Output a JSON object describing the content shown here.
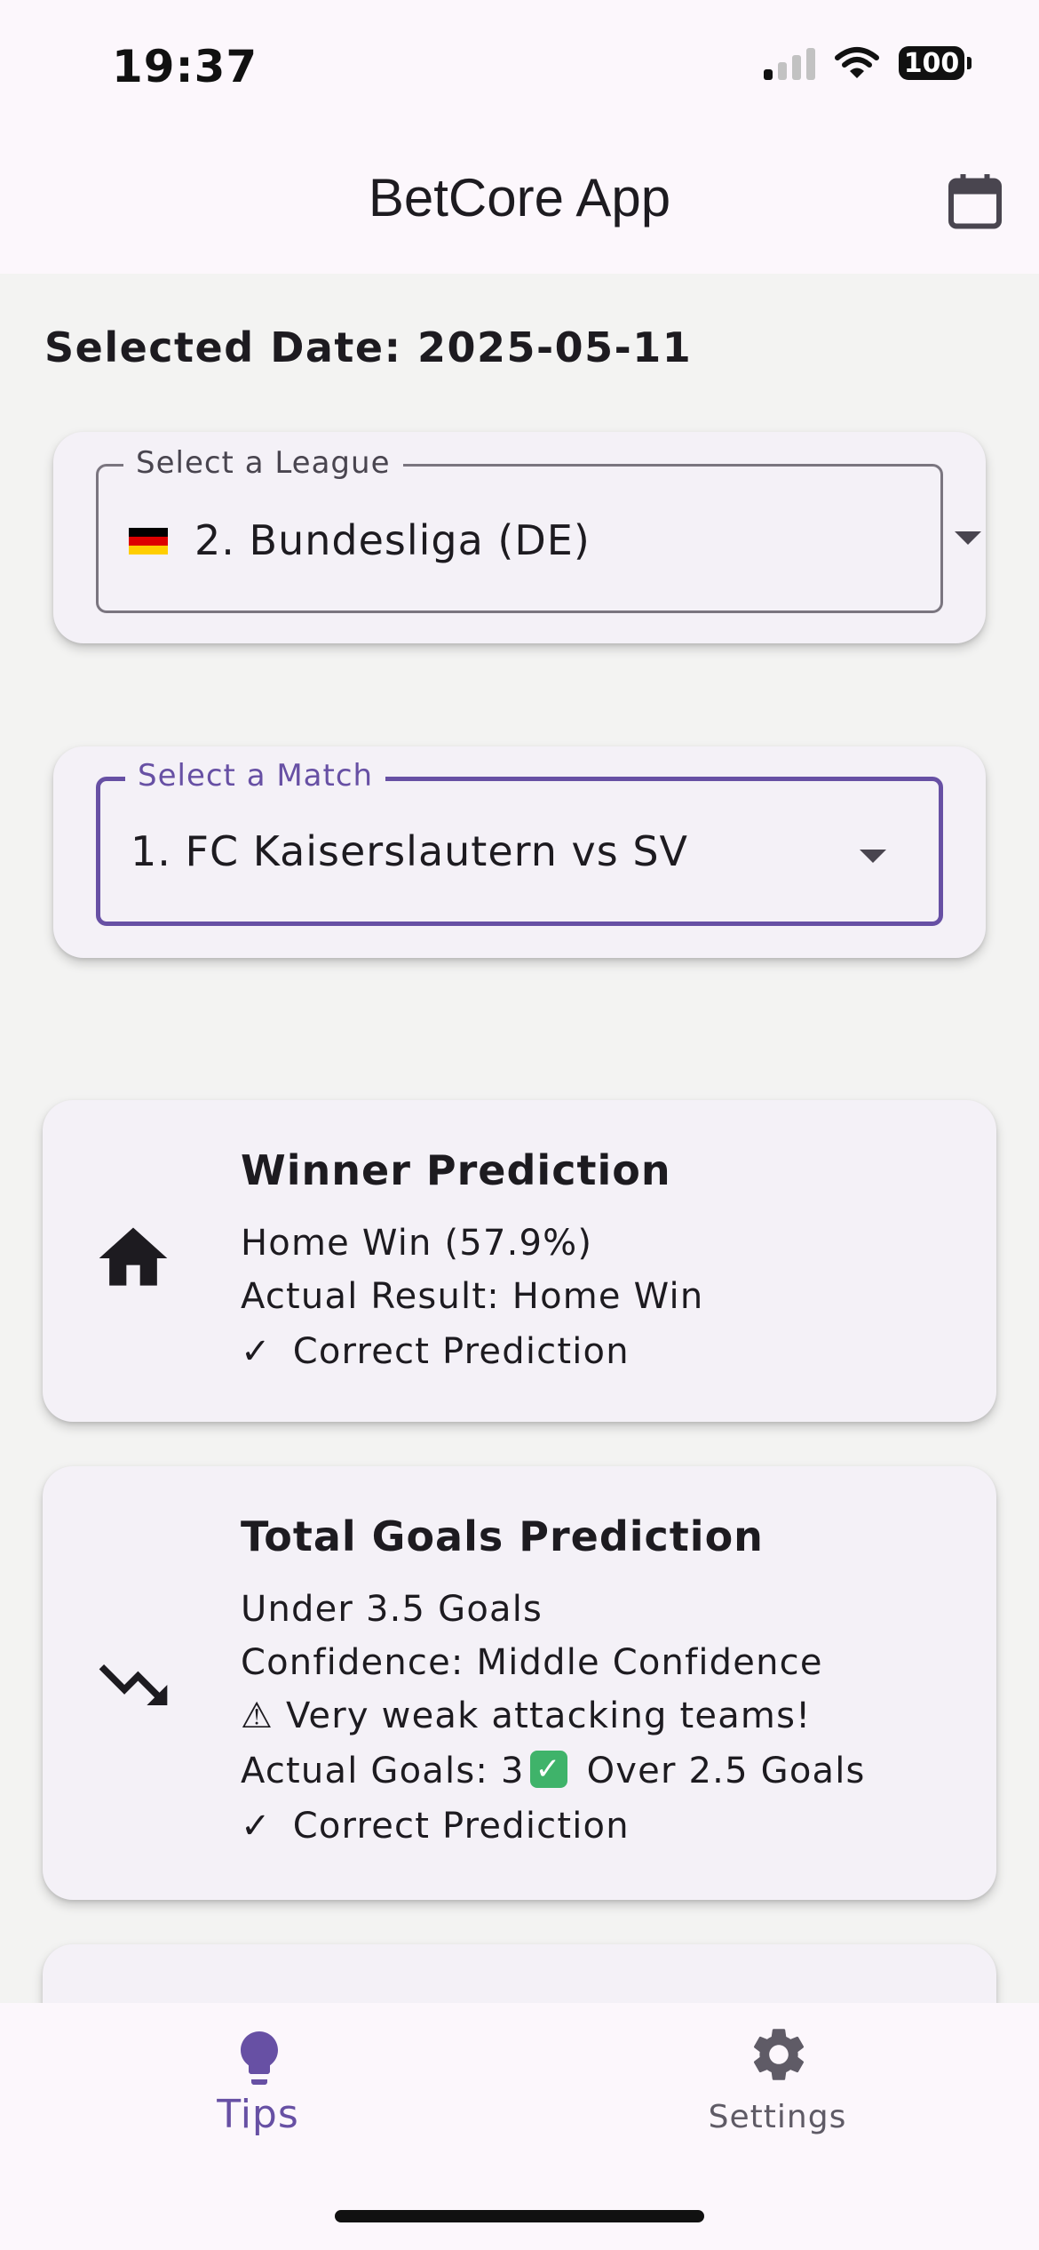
{
  "status_bar": {
    "time": "19:37",
    "battery": "100"
  },
  "app_bar": {
    "title": "BetCore App",
    "calendar_icon": "calendar-icon"
  },
  "selected_date": "Selected Date: 2025-05-11",
  "league_select": {
    "label": "Select a League",
    "value": "2. Bundesliga (DE)"
  },
  "match_select": {
    "label": "Select a Match",
    "value": "1. FC Kaiserslautern vs SV"
  },
  "winner_card": {
    "title": "Winner Prediction",
    "icon": "home-icon",
    "lines": [
      "Home Win (57.9%)",
      "Actual Result: Home Win"
    ],
    "check": "✓",
    "result": "Correct Prediction"
  },
  "goals_card": {
    "title": "Total Goals Prediction",
    "icon": "trending-down-icon",
    "lines": [
      "Under 3.5 Goals",
      "Confidence: Middle Confidence",
      "⚠ Very weak attacking teams!"
    ],
    "actual_prefix": "Actual Goals: 3",
    "actual_suffix": "Over 2.5 Goals",
    "check": "✓",
    "result": "Correct Prediction"
  },
  "bottom_nav": {
    "tips": {
      "label": "Tips",
      "icon": "lightbulb-icon"
    },
    "settings": {
      "label": "Settings",
      "icon": "gear-icon"
    }
  },
  "colors": {
    "accent": "#6750a4",
    "background": "#f3f3f2",
    "card": "#f4f1f7",
    "bar": "#fcf7fc",
    "success": "#3fb36a"
  }
}
